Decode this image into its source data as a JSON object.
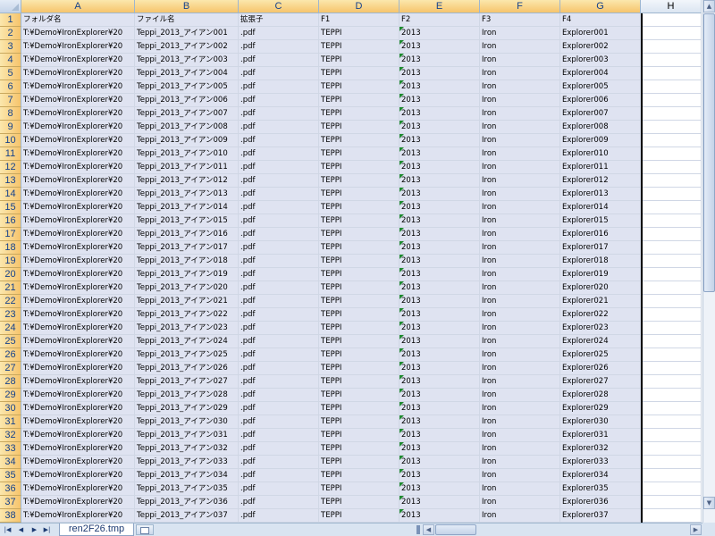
{
  "columns": [
    {
      "letter": "A",
      "highlight": true
    },
    {
      "letter": "B",
      "highlight": true
    },
    {
      "letter": "C",
      "highlight": true
    },
    {
      "letter": "D",
      "highlight": true
    },
    {
      "letter": "E",
      "highlight": true
    },
    {
      "letter": "F",
      "highlight": true
    },
    {
      "letter": "G",
      "highlight": true
    },
    {
      "letter": "H",
      "highlight": false
    }
  ],
  "rows": [
    {
      "num": "1",
      "cells": [
        "フォルダ名",
        "ファイル名",
        "拡張子",
        "F1",
        "F2",
        "F3",
        "F4"
      ]
    },
    {
      "num": "2",
      "cells": [
        "T:¥Demo¥IronExplorer¥20",
        "Teppi_2013_アイアン001",
        ".pdf",
        "TEPPI",
        "2013",
        "Iron",
        "Explorer001"
      ]
    },
    {
      "num": "3",
      "cells": [
        "T:¥Demo¥IronExplorer¥20",
        "Teppi_2013_アイアン002",
        ".pdf",
        "TEPPI",
        "2013",
        "Iron",
        "Explorer002"
      ]
    },
    {
      "num": "4",
      "cells": [
        "T:¥Demo¥IronExplorer¥20",
        "Teppi_2013_アイアン003",
        ".pdf",
        "TEPPI",
        "2013",
        "Iron",
        "Explorer003"
      ]
    },
    {
      "num": "5",
      "cells": [
        "T:¥Demo¥IronExplorer¥20",
        "Teppi_2013_アイアン004",
        ".pdf",
        "TEPPI",
        "2013",
        "Iron",
        "Explorer004"
      ]
    },
    {
      "num": "6",
      "cells": [
        "T:¥Demo¥IronExplorer¥20",
        "Teppi_2013_アイアン005",
        ".pdf",
        "TEPPI",
        "2013",
        "Iron",
        "Explorer005"
      ]
    },
    {
      "num": "7",
      "cells": [
        "T:¥Demo¥IronExplorer¥20",
        "Teppi_2013_アイアン006",
        ".pdf",
        "TEPPI",
        "2013",
        "Iron",
        "Explorer006"
      ]
    },
    {
      "num": "8",
      "cells": [
        "T:¥Demo¥IronExplorer¥20",
        "Teppi_2013_アイアン007",
        ".pdf",
        "TEPPI",
        "2013",
        "Iron",
        "Explorer007"
      ]
    },
    {
      "num": "9",
      "cells": [
        "T:¥Demo¥IronExplorer¥20",
        "Teppi_2013_アイアン008",
        ".pdf",
        "TEPPI",
        "2013",
        "Iron",
        "Explorer008"
      ]
    },
    {
      "num": "10",
      "cells": [
        "T:¥Demo¥IronExplorer¥20",
        "Teppi_2013_アイアン009",
        ".pdf",
        "TEPPI",
        "2013",
        "Iron",
        "Explorer009"
      ]
    },
    {
      "num": "11",
      "cells": [
        "T:¥Demo¥IronExplorer¥20",
        "Teppi_2013_アイアン010",
        ".pdf",
        "TEPPI",
        "2013",
        "Iron",
        "Explorer010"
      ]
    },
    {
      "num": "12",
      "cells": [
        "T:¥Demo¥IronExplorer¥20",
        "Teppi_2013_アイアン011",
        ".pdf",
        "TEPPI",
        "2013",
        "Iron",
        "Explorer011"
      ]
    },
    {
      "num": "13",
      "cells": [
        "T:¥Demo¥IronExplorer¥20",
        "Teppi_2013_アイアン012",
        ".pdf",
        "TEPPI",
        "2013",
        "Iron",
        "Explorer012"
      ]
    },
    {
      "num": "14",
      "cells": [
        "T:¥Demo¥IronExplorer¥20",
        "Teppi_2013_アイアン013",
        ".pdf",
        "TEPPI",
        "2013",
        "Iron",
        "Explorer013"
      ]
    },
    {
      "num": "15",
      "cells": [
        "T:¥Demo¥IronExplorer¥20",
        "Teppi_2013_アイアン014",
        ".pdf",
        "TEPPI",
        "2013",
        "Iron",
        "Explorer014"
      ]
    },
    {
      "num": "16",
      "cells": [
        "T:¥Demo¥IronExplorer¥20",
        "Teppi_2013_アイアン015",
        ".pdf",
        "TEPPI",
        "2013",
        "Iron",
        "Explorer015"
      ]
    },
    {
      "num": "17",
      "cells": [
        "T:¥Demo¥IronExplorer¥20",
        "Teppi_2013_アイアン016",
        ".pdf",
        "TEPPI",
        "2013",
        "Iron",
        "Explorer016"
      ]
    },
    {
      "num": "18",
      "cells": [
        "T:¥Demo¥IronExplorer¥20",
        "Teppi_2013_アイアン017",
        ".pdf",
        "TEPPI",
        "2013",
        "Iron",
        "Explorer017"
      ]
    },
    {
      "num": "19",
      "cells": [
        "T:¥Demo¥IronExplorer¥20",
        "Teppi_2013_アイアン018",
        ".pdf",
        "TEPPI",
        "2013",
        "Iron",
        "Explorer018"
      ]
    },
    {
      "num": "20",
      "cells": [
        "T:¥Demo¥IronExplorer¥20",
        "Teppi_2013_アイアン019",
        ".pdf",
        "TEPPI",
        "2013",
        "Iron",
        "Explorer019"
      ]
    },
    {
      "num": "21",
      "cells": [
        "T:¥Demo¥IronExplorer¥20",
        "Teppi_2013_アイアン020",
        ".pdf",
        "TEPPI",
        "2013",
        "Iron",
        "Explorer020"
      ]
    },
    {
      "num": "22",
      "cells": [
        "T:¥Demo¥IronExplorer¥20",
        "Teppi_2013_アイアン021",
        ".pdf",
        "TEPPI",
        "2013",
        "Iron",
        "Explorer021"
      ]
    },
    {
      "num": "23",
      "cells": [
        "T:¥Demo¥IronExplorer¥20",
        "Teppi_2013_アイアン022",
        ".pdf",
        "TEPPI",
        "2013",
        "Iron",
        "Explorer022"
      ]
    },
    {
      "num": "24",
      "cells": [
        "T:¥Demo¥IronExplorer¥20",
        "Teppi_2013_アイアン023",
        ".pdf",
        "TEPPI",
        "2013",
        "Iron",
        "Explorer023"
      ]
    },
    {
      "num": "25",
      "cells": [
        "T:¥Demo¥IronExplorer¥20",
        "Teppi_2013_アイアン024",
        ".pdf",
        "TEPPI",
        "2013",
        "Iron",
        "Explorer024"
      ]
    },
    {
      "num": "26",
      "cells": [
        "T:¥Demo¥IronExplorer¥20",
        "Teppi_2013_アイアン025",
        ".pdf",
        "TEPPI",
        "2013",
        "Iron",
        "Explorer025"
      ]
    },
    {
      "num": "27",
      "cells": [
        "T:¥Demo¥IronExplorer¥20",
        "Teppi_2013_アイアン026",
        ".pdf",
        "TEPPI",
        "2013",
        "Iron",
        "Explorer026"
      ]
    },
    {
      "num": "28",
      "cells": [
        "T:¥Demo¥IronExplorer¥20",
        "Teppi_2013_アイアン027",
        ".pdf",
        "TEPPI",
        "2013",
        "Iron",
        "Explorer027"
      ]
    },
    {
      "num": "29",
      "cells": [
        "T:¥Demo¥IronExplorer¥20",
        "Teppi_2013_アイアン028",
        ".pdf",
        "TEPPI",
        "2013",
        "Iron",
        "Explorer028"
      ]
    },
    {
      "num": "30",
      "cells": [
        "T:¥Demo¥IronExplorer¥20",
        "Teppi_2013_アイアン029",
        ".pdf",
        "TEPPI",
        "2013",
        "Iron",
        "Explorer029"
      ]
    },
    {
      "num": "31",
      "cells": [
        "T:¥Demo¥IronExplorer¥20",
        "Teppi_2013_アイアン030",
        ".pdf",
        "TEPPI",
        "2013",
        "Iron",
        "Explorer030"
      ]
    },
    {
      "num": "32",
      "cells": [
        "T:¥Demo¥IronExplorer¥20",
        "Teppi_2013_アイアン031",
        ".pdf",
        "TEPPI",
        "2013",
        "Iron",
        "Explorer031"
      ]
    },
    {
      "num": "33",
      "cells": [
        "T:¥Demo¥IronExplorer¥20",
        "Teppi_2013_アイアン032",
        ".pdf",
        "TEPPI",
        "2013",
        "Iron",
        "Explorer032"
      ]
    },
    {
      "num": "34",
      "cells": [
        "T:¥Demo¥IronExplorer¥20",
        "Teppi_2013_アイアン033",
        ".pdf",
        "TEPPI",
        "2013",
        "Iron",
        "Explorer033"
      ]
    },
    {
      "num": "35",
      "cells": [
        "T:¥Demo¥IronExplorer¥20",
        "Teppi_2013_アイアン034",
        ".pdf",
        "TEPPI",
        "2013",
        "Iron",
        "Explorer034"
      ]
    },
    {
      "num": "36",
      "cells": [
        "T:¥Demo¥IronExplorer¥20",
        "Teppi_2013_アイアン035",
        ".pdf",
        "TEPPI",
        "2013",
        "Iron",
        "Explorer035"
      ]
    },
    {
      "num": "37",
      "cells": [
        "T:¥Demo¥IronExplorer¥20",
        "Teppi_2013_アイアン036",
        ".pdf",
        "TEPPI",
        "2013",
        "Iron",
        "Explorer036"
      ]
    },
    {
      "num": "38",
      "cells": [
        "T:¥Demo¥IronExplorer¥20",
        "Teppi_2013_アイアン037",
        ".pdf",
        "TEPPI",
        "2013",
        "Iron",
        "Explorer037"
      ]
    }
  ],
  "sheet_tabs": [
    {
      "label": "ren2F26.tmp",
      "active": true
    }
  ],
  "icons": {
    "nav_first": "first-sheet-icon",
    "nav_prev": "prev-sheet-icon",
    "nav_next": "next-sheet-icon",
    "nav_last": "last-sheet-icon",
    "new_sheet": "insert-worksheet-icon"
  },
  "colors": {
    "selected_header": "#f6c46c",
    "selected_cells": "#dfe3f1",
    "header_text": "#15428b",
    "error_indicator": "#1e8a2f"
  }
}
